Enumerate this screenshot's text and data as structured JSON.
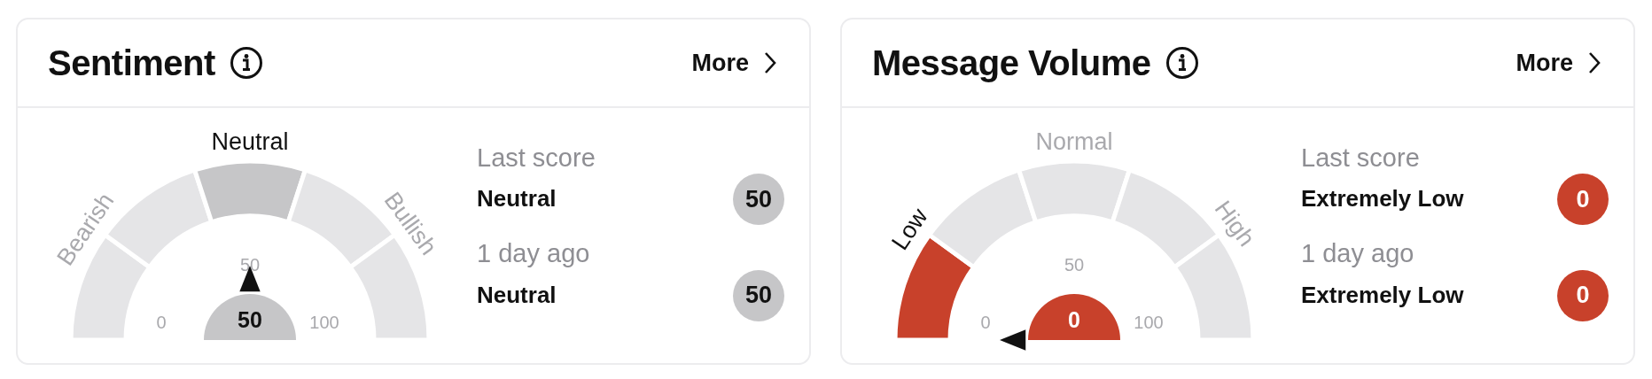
{
  "cards": [
    {
      "title": "Sentiment",
      "more": "More",
      "gauge": {
        "value": "50",
        "color": "#c6c6c8",
        "ticks": [
          "0",
          "50",
          "100"
        ],
        "segments": [
          {
            "selected": false
          },
          {
            "selected": false
          },
          {
            "selected": true
          },
          {
            "selected": false
          },
          {
            "selected": false
          }
        ],
        "labels": [
          {
            "kind": "left",
            "text": "Bearish",
            "selected": false
          },
          {
            "kind": "top",
            "text": "Neutral",
            "selected": true
          },
          {
            "kind": "right",
            "text": "Bullish",
            "selected": false
          }
        ]
      },
      "scores": [
        {
          "label": "Last score",
          "value": "Neutral",
          "badge": "50",
          "color": "#c6c6c8"
        },
        {
          "label": "1 day ago",
          "value": "Neutral",
          "badge": "50",
          "color": "#c6c6c8"
        }
      ]
    },
    {
      "title": "Message Volume",
      "more": "More",
      "gauge": {
        "value": "0",
        "color": "#c8412b",
        "ticks": [
          "0",
          "50",
          "100"
        ],
        "segments": [
          {
            "selected": true
          },
          {
            "selected": false
          },
          {
            "selected": false
          },
          {
            "selected": false
          },
          {
            "selected": false
          }
        ],
        "labels": [
          {
            "kind": "left",
            "text": "Low",
            "selected": true
          },
          {
            "kind": "top",
            "text": "Normal",
            "selected": false
          },
          {
            "kind": "right",
            "text": "High",
            "selected": false
          }
        ]
      },
      "scores": [
        {
          "label": "Last score",
          "value": "Extremely Low",
          "badge": "0",
          "color": "#c8412b"
        },
        {
          "label": "1 day ago",
          "value": "Extremely Low",
          "badge": "0",
          "color": "#c8412b"
        }
      ]
    }
  ]
}
